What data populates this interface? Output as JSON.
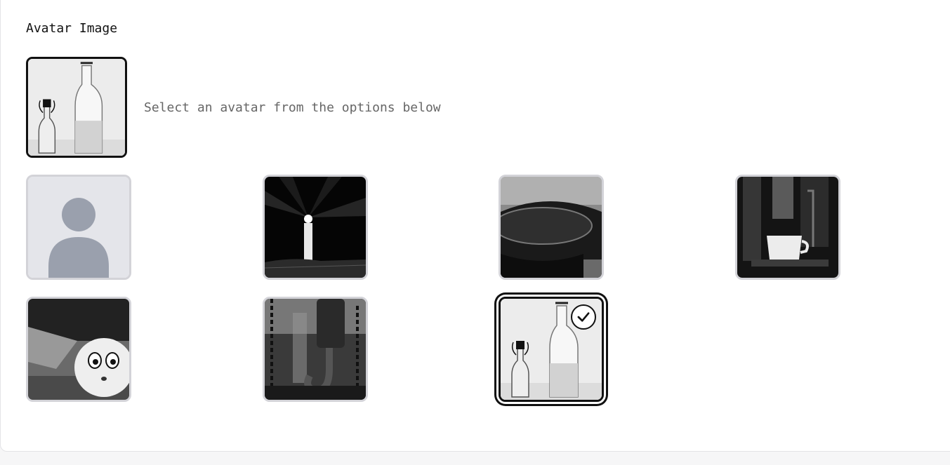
{
  "section": {
    "title": "Avatar Image",
    "hint": "Select an avatar from the options below"
  },
  "avatar_options": [
    {
      "icon": "default-person-icon",
      "selected": false
    },
    {
      "icon": "lighthouse-photo",
      "selected": false
    },
    {
      "icon": "cup-rim-photo",
      "selected": false
    },
    {
      "icon": "espresso-machine-photo",
      "selected": false
    },
    {
      "icon": "worried-ball-photo",
      "selected": false
    },
    {
      "icon": "crane-hook-photo",
      "selected": false
    },
    {
      "icon": "bottles-photo",
      "selected": true
    }
  ],
  "colors": {
    "selected_border": "#111111",
    "unselected_border": "#d3d3d8",
    "placeholder_bg": "#e4e5ea",
    "placeholder_figure": "#9aa0ad"
  }
}
